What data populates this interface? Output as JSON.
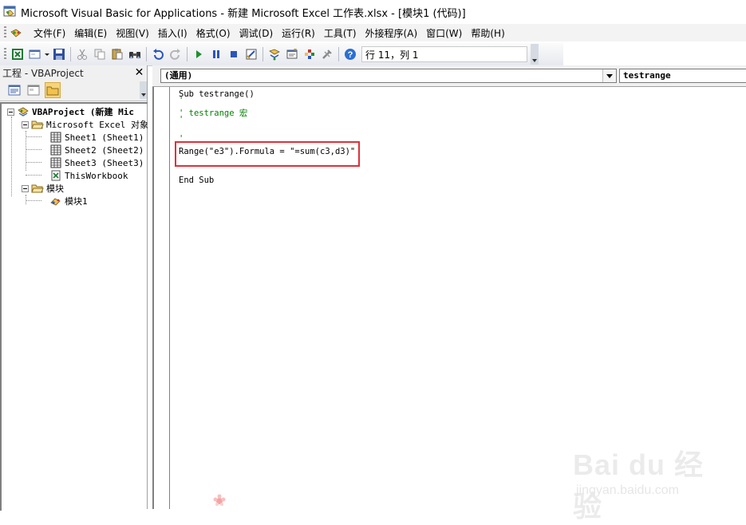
{
  "window": {
    "title": "Microsoft Visual Basic for Applications - 新建 Microsoft Excel 工作表.xlsx - [模块1 (代码)]"
  },
  "menu": {
    "items": [
      "文件(F)",
      "编辑(E)",
      "视图(V)",
      "插入(I)",
      "格式(O)",
      "调试(D)",
      "运行(R)",
      "工具(T)",
      "外接程序(A)",
      "窗口(W)",
      "帮助(H)"
    ]
  },
  "toolbar": {
    "position_label": "行 11，列 1",
    "icons": [
      "excel-icon",
      "insert-userform-icon",
      "save-icon",
      "cut-icon",
      "copy-icon",
      "paste-icon",
      "find-icon",
      "undo-icon",
      "redo-icon",
      "run-icon",
      "break-icon",
      "reset-icon",
      "design-mode-icon",
      "project-explorer-icon",
      "properties-icon",
      "object-browser-icon",
      "toolbox-icon",
      "help-icon"
    ]
  },
  "project_pane": {
    "title": "工程 - VBAProject",
    "tree": {
      "root": "VBAProject (新建 Mic",
      "excel_objects_folder": "Microsoft Excel 对象",
      "sheets": [
        "Sheet1 (Sheet1)",
        "Sheet2 (Sheet2)",
        "Sheet3 (Sheet3)"
      ],
      "workbook": "ThisWorkbook",
      "modules_folder": "模块",
      "module": "模块1"
    }
  },
  "code_window": {
    "object_combo": "(通用)",
    "procedure_combo": "testrange",
    "lines": [
      {
        "text": "Sub testrange()",
        "type": "code"
      },
      {
        "text": "'",
        "type": "comment"
      },
      {
        "text": "' testrange 宏",
        "type": "comment"
      },
      {
        "text": "'",
        "type": "comment"
      },
      {
        "text": "",
        "type": "code"
      },
      {
        "text": "'",
        "type": "comment"
      },
      {
        "text": "Range(\"e3\").Formula = \"=sum(c3,d3)\"",
        "type": "code"
      },
      {
        "text": "",
        "type": "code"
      },
      {
        "text": "End Sub",
        "type": "code"
      }
    ]
  },
  "watermark": {
    "brand": "Bai du 经验",
    "url": "jingyan.baidu.com"
  },
  "colors": {
    "highlight_box": "#e0303a",
    "comment": "#008000"
  }
}
